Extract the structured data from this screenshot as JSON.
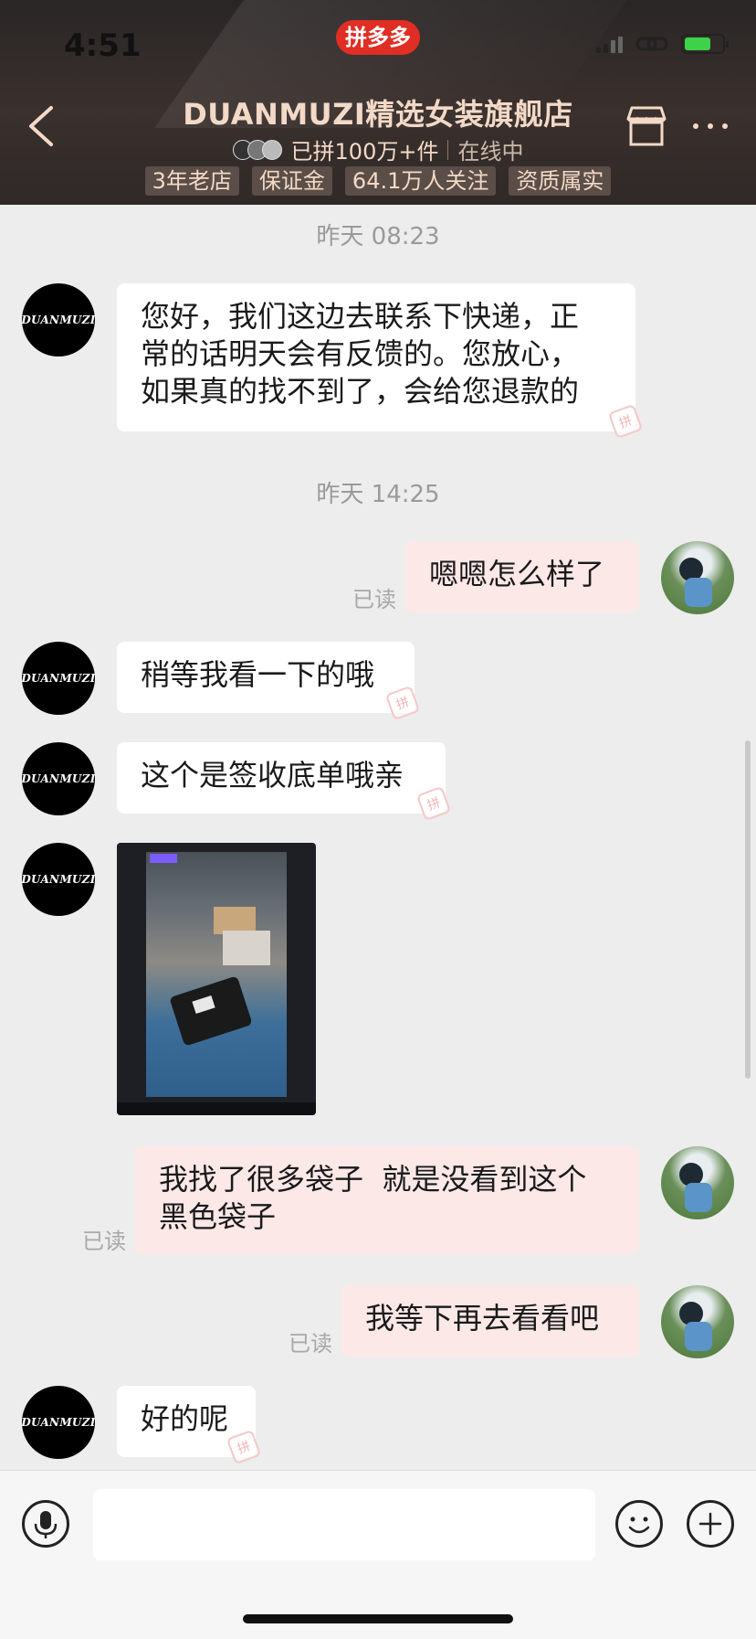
{
  "status_bar": {
    "time": "4:51",
    "app_badge": "拼多多"
  },
  "header": {
    "title": "DUANMUZI精选女装旗舰店",
    "sold": "已拼100万+件",
    "online": "在线中",
    "tags": [
      "3年老店",
      "保证金",
      "64.1万人关注",
      "资质属实"
    ],
    "icons": [
      "back-arrow-icon",
      "store-icon",
      "more-dots-icon"
    ]
  },
  "shop_avatar_text": "DUANMUZI",
  "chat": {
    "timestamps": [
      "昨天 08:23",
      "昨天 14:25"
    ],
    "messages": [
      {
        "from": "shop",
        "text": "您好，我们这边去联系下快递，正\n常的话明天会有反馈的。您放心，\n如果真的找不到了，会给您退款的"
      },
      {
        "from": "me",
        "text": "嗯嗯怎么样了",
        "status": "已读"
      },
      {
        "from": "shop",
        "text": "稍等我看一下的哦"
      },
      {
        "from": "shop",
        "text": "这个是签收底单哦亲"
      },
      {
        "from": "shop",
        "type": "image",
        "description": "签收底单照片"
      },
      {
        "from": "me",
        "text": "我找了很多袋子  就是没看到这个\n黑色袋子",
        "status": "已读"
      },
      {
        "from": "me",
        "text": "我等下再去看看吧",
        "status": "已读"
      },
      {
        "from": "shop",
        "text": "好的呢"
      }
    ],
    "stamp_glyph": "拼"
  },
  "input_bar": {
    "placeholder": "",
    "icons": [
      "microphone-icon",
      "emoji-icon",
      "plus-icon"
    ]
  }
}
